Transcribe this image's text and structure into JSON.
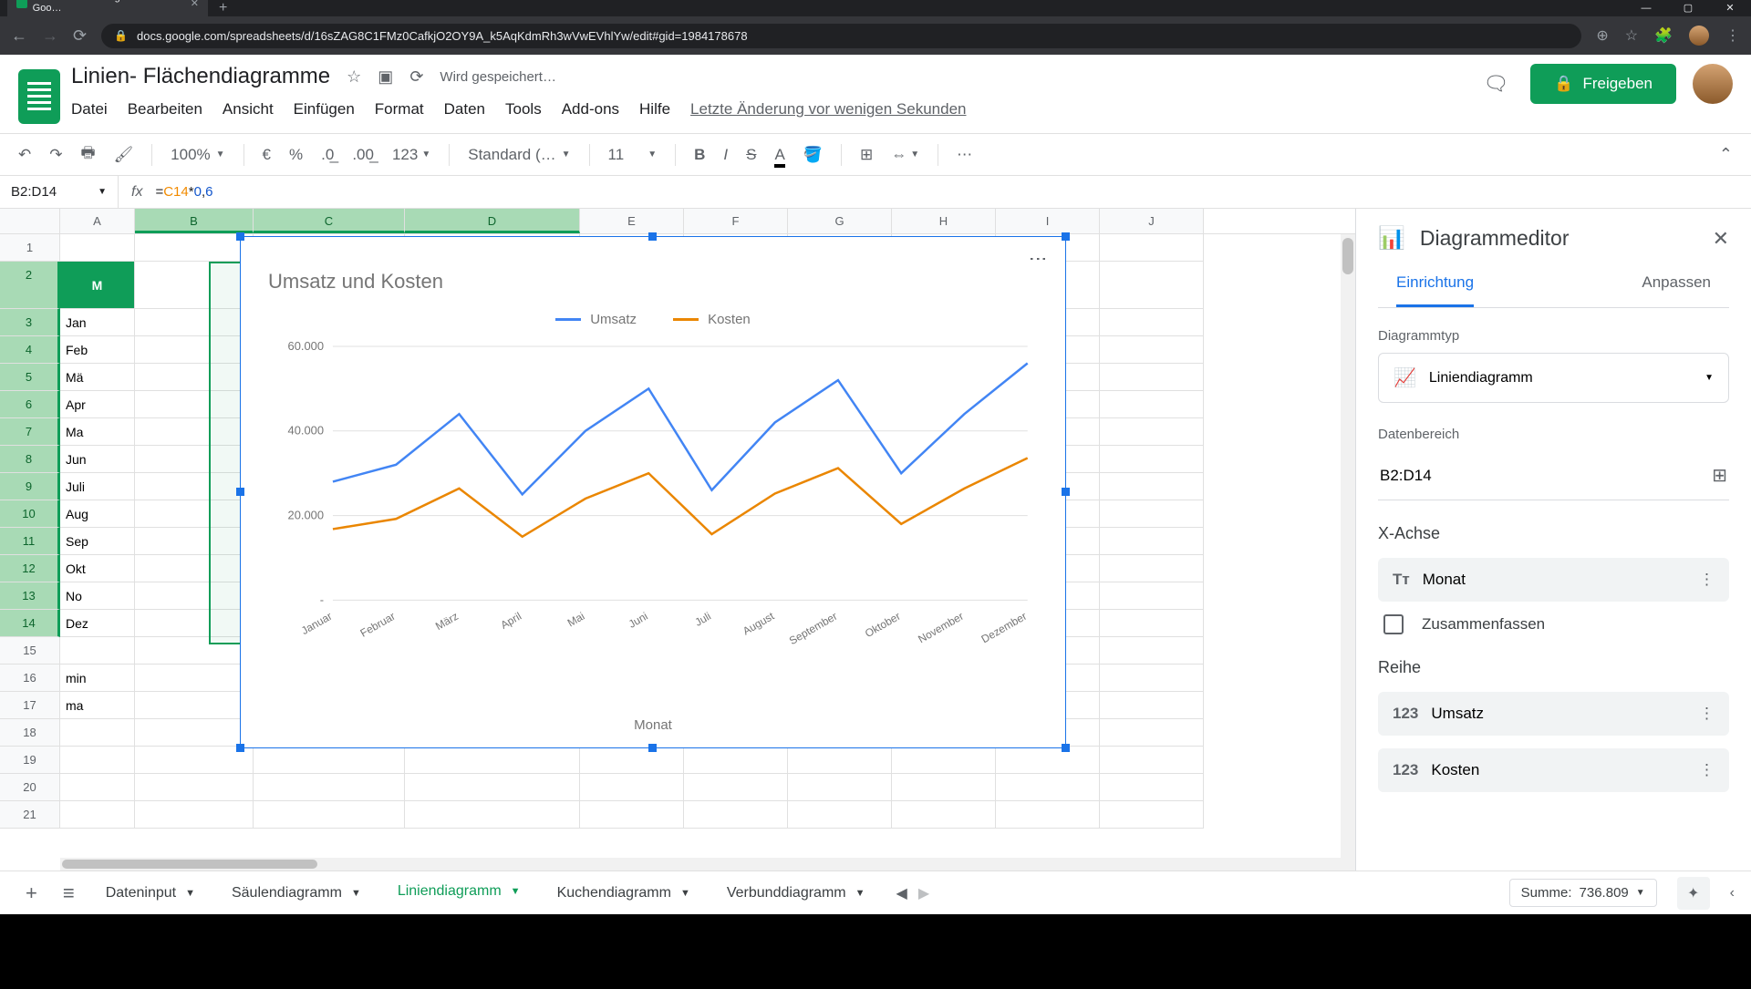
{
  "browser": {
    "tab_title": "Linien- Flächendiagramme - Goo…",
    "url": "docs.google.com/spreadsheets/d/16sZAG8C1FMz0CafkjO2OY9A_k5AqKdmRh3wVwEVhlYw/edit#gid=1984178678"
  },
  "doc": {
    "title": "Linien- Flächendiagramme",
    "saving": "Wird gespeichert…",
    "last_edit": "Letzte Änderung vor wenigen Sekunden"
  },
  "menu": {
    "file": "Datei",
    "edit": "Bearbeiten",
    "view": "Ansicht",
    "insert": "Einfügen",
    "format": "Format",
    "data": "Daten",
    "tools": "Tools",
    "addons": "Add-ons",
    "help": "Hilfe"
  },
  "share": {
    "label": "Freigeben"
  },
  "toolbar": {
    "zoom": "100%",
    "currency": "€",
    "percent": "%",
    "dec_dec": ".0",
    "inc_dec": ".00",
    "numfmt": "123",
    "font": "Standard (…",
    "size": "11"
  },
  "namebox": "B2:D14",
  "formula": {
    "prefix": "=",
    "ref": "C14",
    "op": "*",
    "num0": "0",
    "comma": ",",
    "num1": "6"
  },
  "columns": [
    "A",
    "B",
    "C",
    "D",
    "E",
    "F",
    "G",
    "H",
    "I",
    "J"
  ],
  "rows_visible": [
    "Jan",
    "Feb",
    "Mä",
    "Apr",
    "Ma",
    "Jun",
    "Juli",
    "Aug",
    "Sep",
    "Okt",
    "No",
    "Dez"
  ],
  "extra_rows": {
    "min": "min",
    "max": "ma"
  },
  "chart_data": {
    "type": "line",
    "title": "Umsatz und Kosten",
    "xlabel": "Monat",
    "ylabel": "",
    "y_ticks": [
      "60.000",
      "40.000",
      "20.000",
      "-"
    ],
    "ylim": [
      0,
      60000
    ],
    "categories": [
      "Januar",
      "Februar",
      "März",
      "April",
      "Mai",
      "Juni",
      "Juli",
      "August",
      "September",
      "Oktober",
      "November",
      "Dezember"
    ],
    "series": [
      {
        "name": "Umsatz",
        "color": "#4285f4",
        "values": [
          28000,
          32000,
          44000,
          25000,
          40000,
          50000,
          26000,
          42000,
          52000,
          30000,
          44000,
          56000
        ]
      },
      {
        "name": "Kosten",
        "color": "#ea8600",
        "values": [
          16800,
          19200,
          26400,
          15000,
          24000,
          30000,
          15600,
          25200,
          31200,
          18000,
          26400,
          33600
        ]
      }
    ]
  },
  "editor": {
    "title": "Diagrammeditor",
    "tabs": {
      "setup": "Einrichtung",
      "customize": "Anpassen"
    },
    "chart_type_label": "Diagrammtyp",
    "chart_type_value": "Liniendiagramm",
    "data_range_label": "Datenbereich",
    "data_range_value": "B2:D14",
    "x_axis_label": "X-Achse",
    "x_axis_value": "Monat",
    "aggregate": "Zusammenfassen",
    "series_label": "Reihe",
    "series": [
      "Umsatz",
      "Kosten"
    ]
  },
  "sheets": {
    "input": "Dateninput",
    "bar": "Säulendiagramm",
    "line": "Liniendiagramm",
    "pie": "Kuchendiagramm",
    "combo": "Verbunddiagramm"
  },
  "status": {
    "sum_label": "Summe:",
    "sum_value": "736.809"
  }
}
